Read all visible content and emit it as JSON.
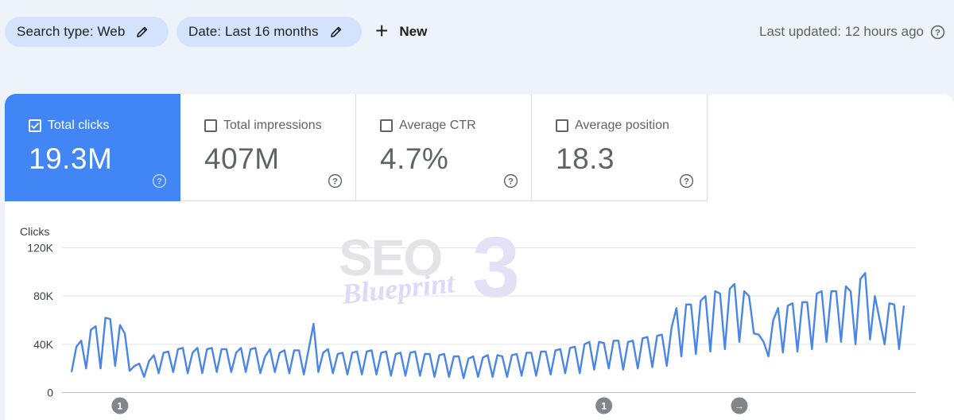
{
  "toolbar": {
    "search_type_label": "Search type: Web",
    "date_label": "Date: Last 16 months",
    "new_label": "New",
    "last_updated": "Last updated: 12 hours ago"
  },
  "metrics": [
    {
      "label": "Total clicks",
      "value": "19.3M",
      "checked": true
    },
    {
      "label": "Total impressions",
      "value": "407M",
      "checked": false
    },
    {
      "label": "Average CTR",
      "value": "4.7%",
      "checked": false
    },
    {
      "label": "Average position",
      "value": "18.3",
      "checked": false
    }
  ],
  "watermark": {
    "line1": "SEO",
    "line2": "Blueprint",
    "number": "3"
  },
  "colors": {
    "accent": "#4285f4",
    "chip": "#d3e3fd",
    "line": "#4a86e8",
    "background": "#eef2f9"
  },
  "chart_data": {
    "type": "line",
    "ylabel": "Clicks",
    "ylim": [
      0,
      120000
    ],
    "yticks": [
      {
        "value": 0,
        "label": "0"
      },
      {
        "value": 40000,
        "label": "40K"
      },
      {
        "value": 80000,
        "label": "80K"
      },
      {
        "value": 120000,
        "label": "120K"
      }
    ],
    "grid": true,
    "series": [
      {
        "values": [
          17000,
          38000,
          43000,
          20000,
          52000,
          55000,
          20000,
          62000,
          61000,
          22000,
          56000,
          49000,
          18000,
          22000,
          24000,
          13000,
          26000,
          31000,
          16000,
          33000,
          34000,
          17000,
          36000,
          37000,
          16000,
          33000,
          37000,
          16000,
          36000,
          37000,
          17000,
          36000,
          36000,
          17000,
          33000,
          37000,
          17000,
          36000,
          37000,
          16000,
          30000,
          36000,
          17000,
          33000,
          35000,
          16000,
          35000,
          35000,
          15000,
          36000,
          57000,
          17000,
          33000,
          36000,
          16000,
          32000,
          33000,
          15000,
          33000,
          34000,
          15000,
          34000,
          35000,
          15000,
          33000,
          34000,
          14000,
          32000,
          33000,
          14000,
          33000,
          34000,
          14000,
          32000,
          32000,
          13000,
          31000,
          32000,
          13000,
          30000,
          30000,
          12000,
          28000,
          30000,
          13000,
          29000,
          31000,
          13000,
          31000,
          30000,
          13000,
          31000,
          32000,
          14000,
          33000,
          33000,
          14000,
          34000,
          34000,
          15000,
          35000,
          36000,
          16000,
          37000,
          38000,
          16000,
          40000,
          42000,
          19000,
          42000,
          41000,
          20000,
          43000,
          43000,
          19000,
          42000,
          43000,
          20000,
          45000,
          46000,
          21000,
          47000,
          48000,
          22000,
          54000,
          70000,
          30000,
          73000,
          73000,
          32000,
          76000,
          80000,
          34000,
          84000,
          82000,
          36000,
          86000,
          90000,
          42000,
          84000,
          80000,
          49000,
          48000,
          42000,
          30000,
          60000,
          70000,
          33000,
          72000,
          74000,
          34000,
          75000,
          75000,
          36000,
          82000,
          84000,
          42000,
          84000,
          84000,
          42000,
          88000,
          84000,
          40000,
          94000,
          99000,
          44000,
          80000,
          60000,
          40000,
          74000,
          73000,
          36000,
          72000
        ],
        "annotations": [
          {
            "index": 10,
            "label": "1"
          },
          {
            "index": 110,
            "label": "1"
          },
          {
            "index": 138,
            "label": "→"
          }
        ]
      }
    ]
  }
}
